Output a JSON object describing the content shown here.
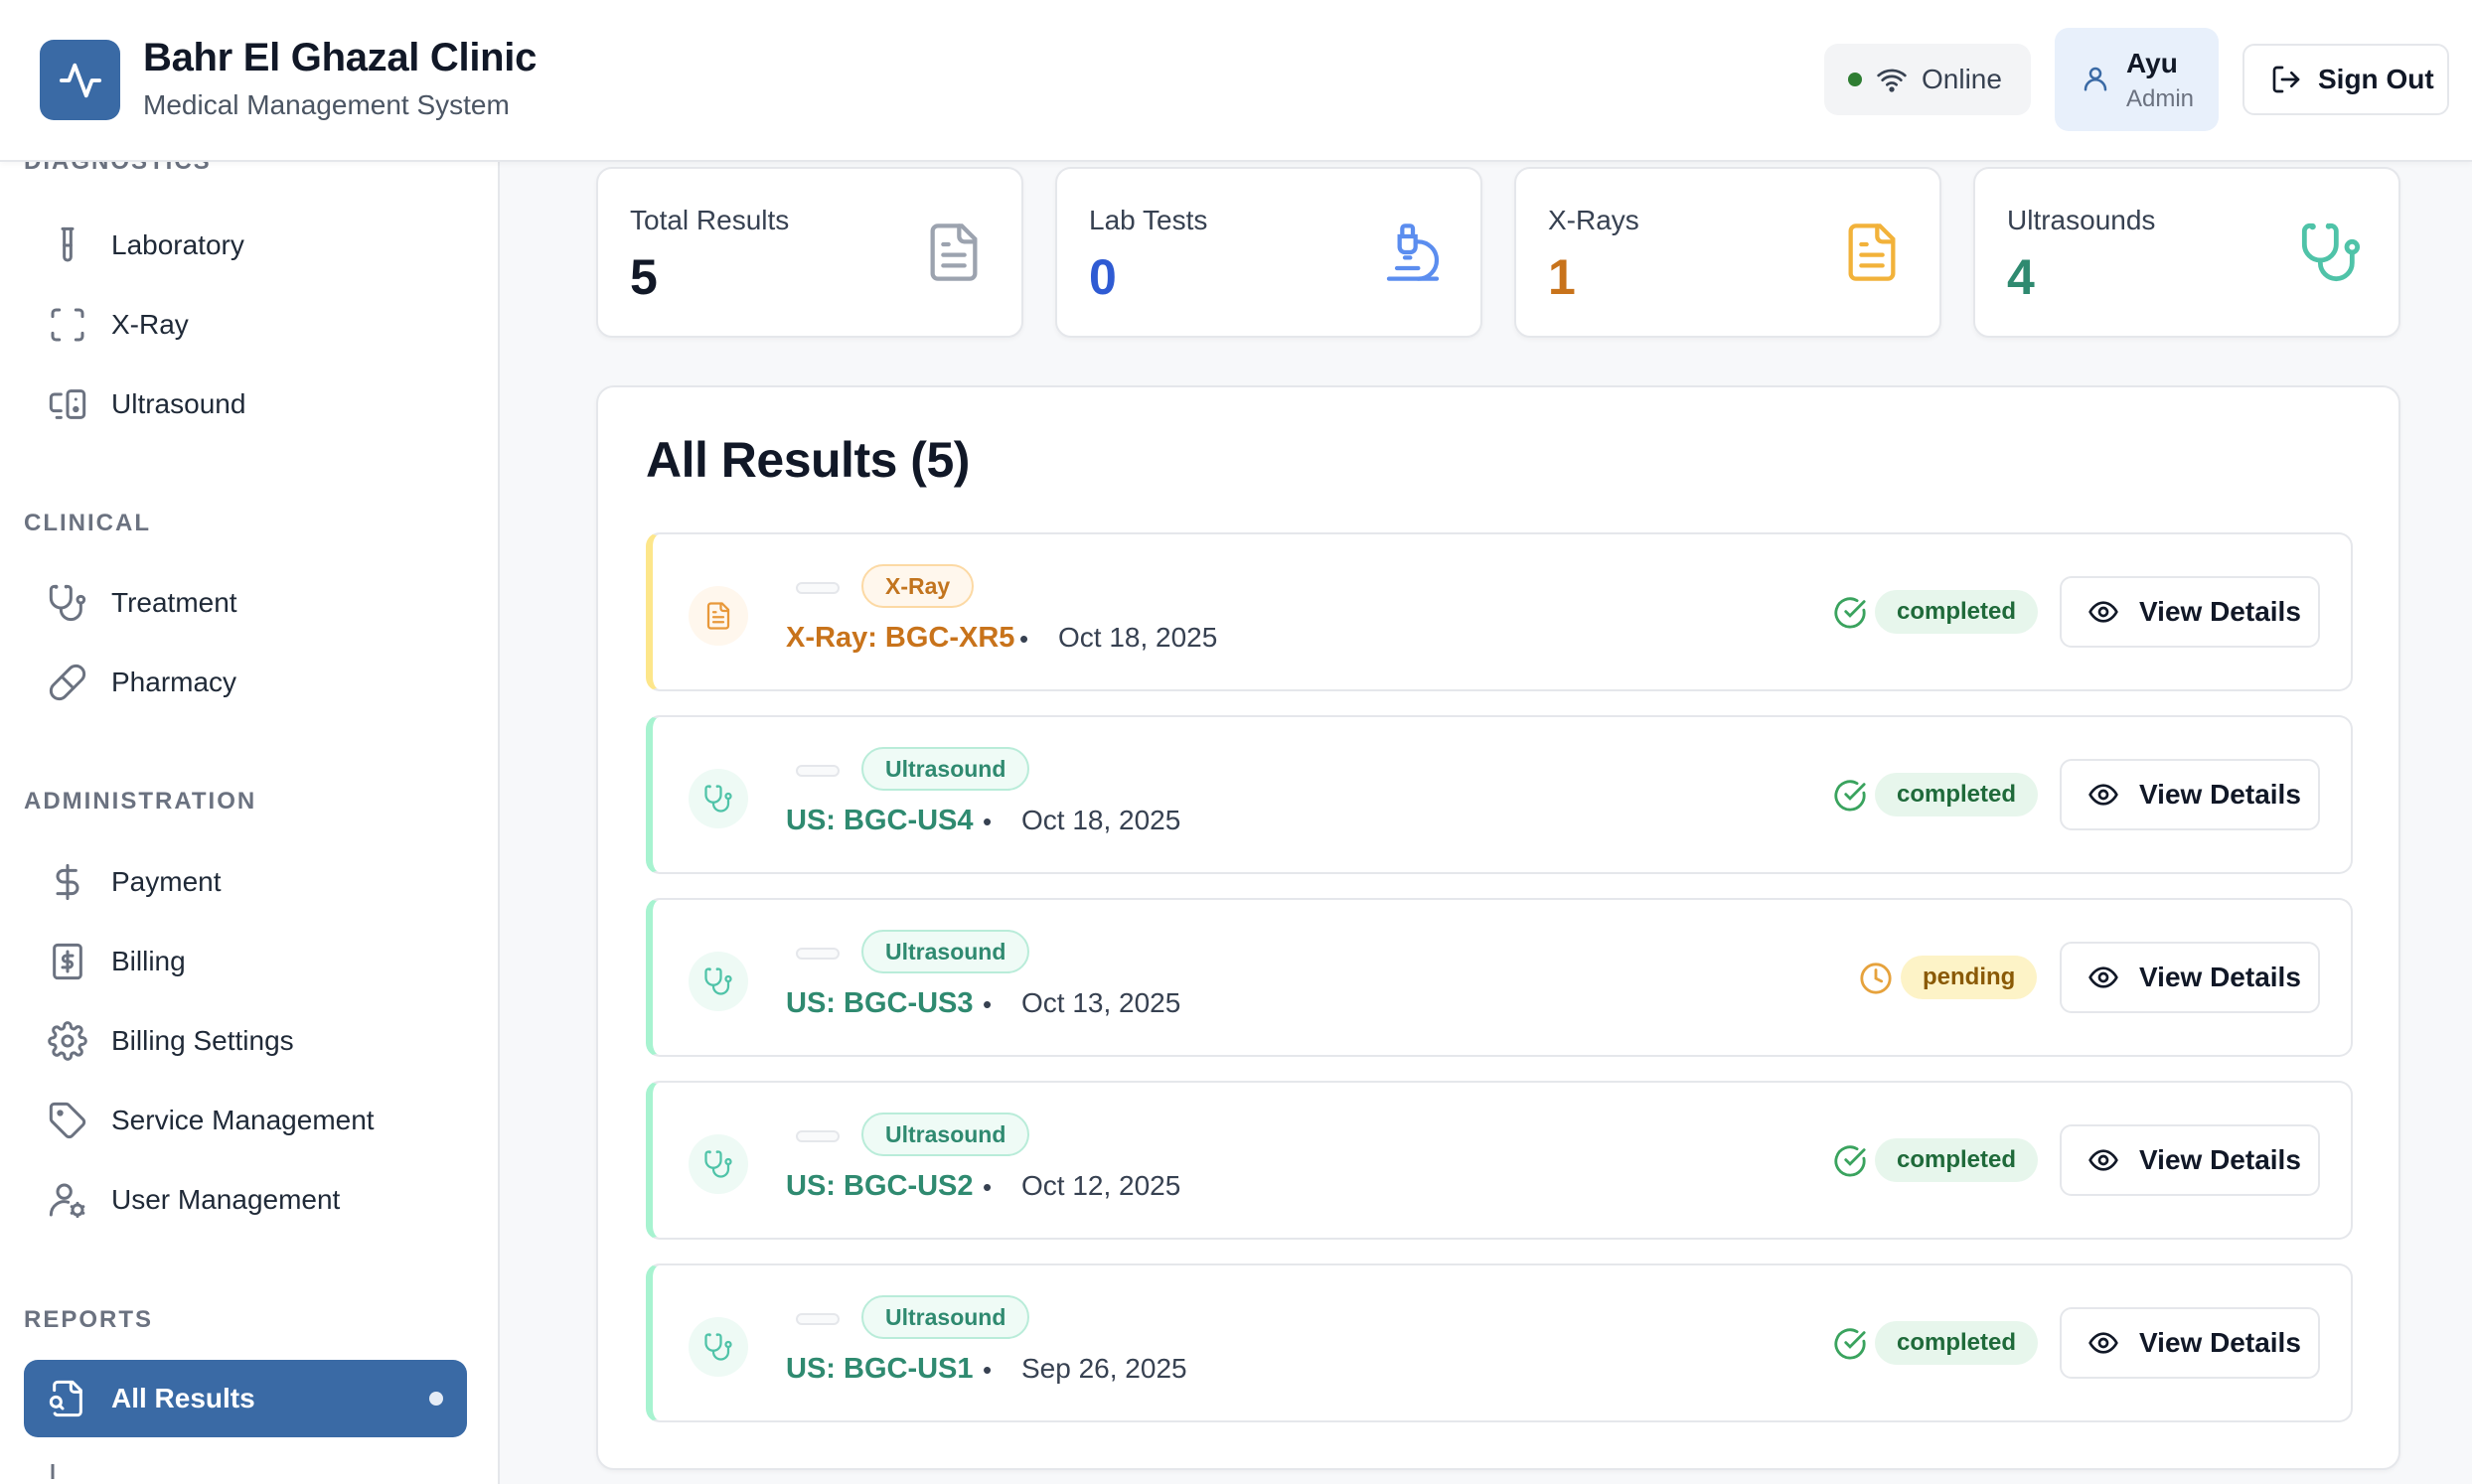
{
  "header": {
    "clinic_name": "Bahr El Ghazal Clinic",
    "subtitle": "Medical Management System",
    "status": "Online",
    "user_name": "Ayu",
    "user_role": "Admin",
    "sign_out": "Sign Out"
  },
  "sidebar": {
    "sections": {
      "diagnostics": "DIAGNOSTICS",
      "clinical": "CLINICAL",
      "administration": "ADMINISTRATION",
      "reports": "REPORTS"
    },
    "items": {
      "laboratory": "Laboratory",
      "xray": "X-Ray",
      "ultrasound": "Ultrasound",
      "treatment": "Treatment",
      "pharmacy": "Pharmacy",
      "payment": "Payment",
      "billing": "Billing",
      "billing_settings": "Billing Settings",
      "service_management": "Service Management",
      "user_management": "User Management",
      "all_results": "All Results"
    }
  },
  "stats": [
    {
      "label": "Total Results",
      "value": "5",
      "color": "#111827",
      "icon": "file-text-icon"
    },
    {
      "label": "Lab Tests",
      "value": "0",
      "color": "#2f5bd3",
      "icon": "microscope-icon"
    },
    {
      "label": "X-Rays",
      "value": "1",
      "color": "#c8731b",
      "icon": "file-text-icon"
    },
    {
      "label": "Ultrasounds",
      "value": "4",
      "color": "#2f8a70",
      "icon": "stethoscope-icon"
    }
  ],
  "results": {
    "title": "All Results (5)",
    "view_label": "View Details",
    "rows": [
      {
        "type": "X-Ray",
        "title": "X-Ray: BGC-XR5",
        "date": "Oct 18, 2025",
        "status": "completed"
      },
      {
        "type": "Ultrasound",
        "title": "US: BGC-US4",
        "date": "Oct 18, 2025",
        "status": "completed"
      },
      {
        "type": "Ultrasound",
        "title": "US: BGC-US3",
        "date": "Oct 13, 2025",
        "status": "pending"
      },
      {
        "type": "Ultrasound",
        "title": "US: BGC-US2",
        "date": "Oct 12, 2025",
        "status": "completed"
      },
      {
        "type": "Ultrasound",
        "title": "US: BGC-US1",
        "date": "Sep 26, 2025",
        "status": "completed"
      }
    ]
  },
  "colors": {
    "primary": "#3a6aa5",
    "xray_accent": "#c8731b",
    "us_accent": "#2f8a70",
    "completed": "#1f6a3a",
    "pending": "#8a5a06"
  }
}
